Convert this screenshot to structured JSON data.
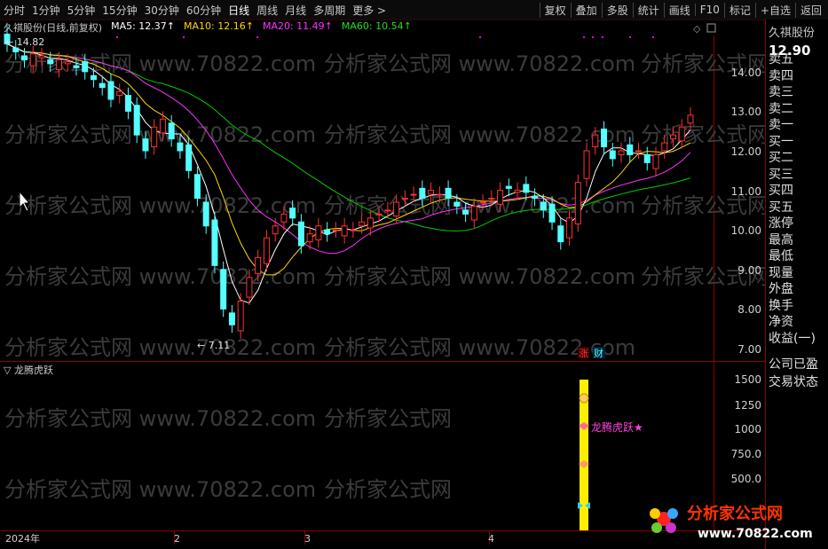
{
  "toolbar": {
    "periods": [
      "分时",
      "1分钟",
      "5分钟",
      "15分钟",
      "30分钟",
      "60分钟",
      "日线",
      "周线",
      "月线",
      "多周期",
      "更多 >"
    ],
    "active": "日线",
    "actions": [
      "复权",
      "叠加",
      "多股",
      "统计",
      "画线",
      "F10",
      "标记",
      "+自选",
      "返回"
    ]
  },
  "header": {
    "stock": "久祺股份(日线,前复权)",
    "ma5": "MA5: 12.37↑",
    "ma10": "MA10: 12.16↑",
    "ma20": "MA20: 11.49↑",
    "ma60": "MA60: 10.54↑"
  },
  "colors": {
    "up": "#ff3232",
    "down": "#54ffff",
    "ma5": "#ffffff",
    "ma10": "#ffd700",
    "ma20": "#ff33ff",
    "ma60": "#00cc00",
    "grid": "#8b0000"
  },
  "price_axis": {
    "labels": [
      "14.00",
      "13.00",
      "12.00",
      "11.00",
      "10.00",
      "9.00",
      "8.00",
      "7.00"
    ]
  },
  "sub_axis": {
    "labels": [
      "1500",
      "1250",
      "1000",
      "750.0",
      "500.0"
    ]
  },
  "time_axis": {
    "labels": [
      "2024年",
      "2",
      "3",
      "4"
    ]
  },
  "annotations": {
    "high": "14.82",
    "low": "7.11",
    "zhang": "涨",
    "cai": "财"
  },
  "indicator": {
    "title": "龙腾虎跃",
    "signal": "龙腾虎跃★"
  },
  "right_panel": {
    "name": "久祺股份",
    "price": "12.90",
    "rows": [
      "卖五",
      "卖四",
      "卖三",
      "卖二",
      "卖一",
      "买一",
      "买二",
      "买三",
      "买四",
      "买五",
      "涨停",
      "最高",
      "最低",
      "现量",
      "外盘",
      "换手",
      "净资",
      "收益(一)"
    ],
    "bottom": [
      "公司已盈",
      "交易状态"
    ]
  },
  "watermark": "分析家公式网 www.70822.com",
  "logo": {
    "title": "分析家公式网",
    "url": "www.70822.com"
  }
}
